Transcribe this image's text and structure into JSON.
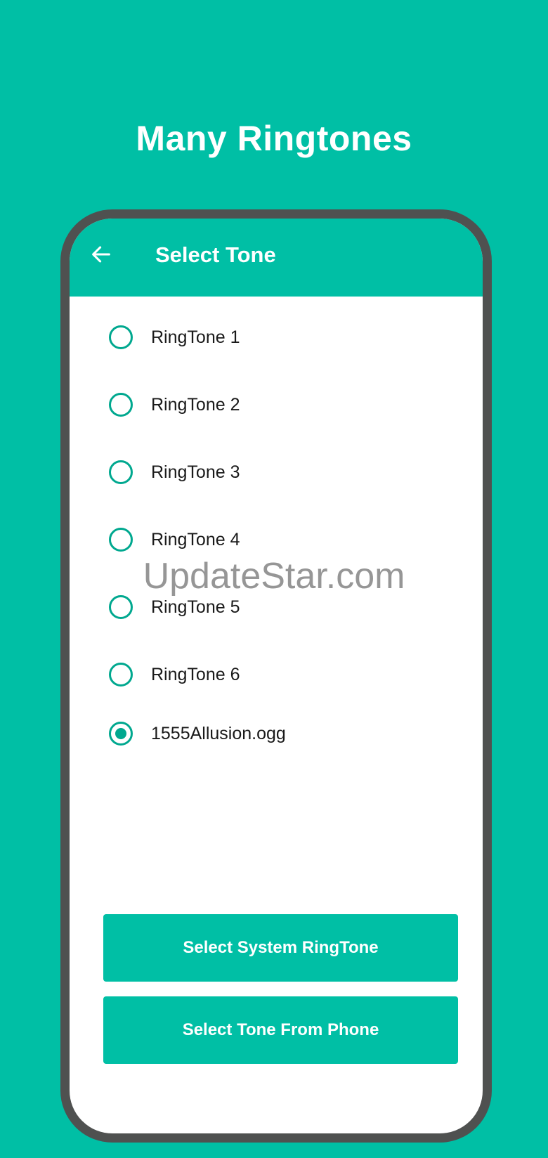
{
  "headline": "Many Ringtones",
  "appbar": {
    "title": "Select Tone",
    "back_icon": "arrow-left-icon"
  },
  "tones": [
    {
      "label": "RingTone 1",
      "selected": false
    },
    {
      "label": "RingTone 2",
      "selected": false
    },
    {
      "label": "RingTone 3",
      "selected": false
    },
    {
      "label": "RingTone 4",
      "selected": false
    },
    {
      "label": "RingTone 5",
      "selected": false
    },
    {
      "label": "RingTone 6",
      "selected": false
    },
    {
      "label": "1555Allusion.ogg",
      "selected": true
    }
  ],
  "buttons": {
    "system_label": "Select System RingTone",
    "phone_label": "Select Tone From Phone"
  },
  "watermark": "UpdateStar.com",
  "colors": {
    "accent": "#00BFA5",
    "radio": "#00A88F",
    "frame": "#4F5150"
  }
}
